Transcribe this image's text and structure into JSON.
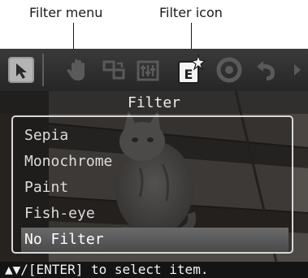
{
  "callouts": {
    "filter_menu": "Filter menu",
    "filter_icon": "Filter icon"
  },
  "toolbar": {
    "items": [
      {
        "icon": "cursor-icon"
      },
      {
        "icon": "hand-icon"
      },
      {
        "icon": "crop-icon"
      },
      {
        "icon": "adjust-icon"
      },
      {
        "icon": "filter-icon",
        "selected": true
      },
      {
        "icon": "redeye-icon"
      },
      {
        "icon": "undo-icon"
      },
      {
        "icon": "scroll-right-icon"
      }
    ]
  },
  "menu": {
    "title": "Filter",
    "items": [
      {
        "label": "Sepia"
      },
      {
        "label": "Monochrome"
      },
      {
        "label": "Paint"
      },
      {
        "label": "Fish-eye"
      },
      {
        "label": "No Filter",
        "selected": true
      }
    ]
  },
  "status": {
    "text": "▲▼/[ENTER] to select item."
  },
  "colors": {
    "screen_bg": "#1c1c1c",
    "toolbar_bg": "#2e2e2e",
    "selected_row": "#5a5a5a",
    "menu_border": "#d8d8d8"
  }
}
